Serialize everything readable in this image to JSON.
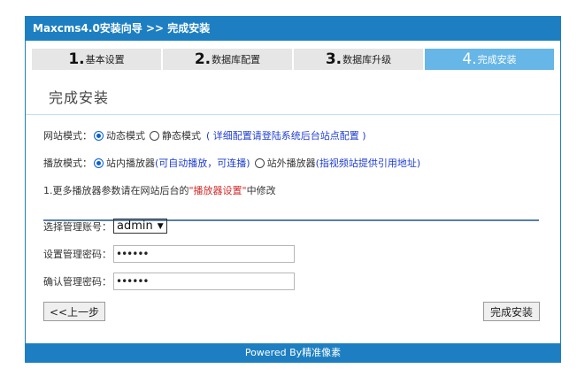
{
  "header": {
    "title": "Maxcms4.0安装向导 >> 完成安装"
  },
  "steps": [
    {
      "num": "1.",
      "label": "基本设置",
      "active": false
    },
    {
      "num": "2.",
      "label": "数据库配置",
      "active": false
    },
    {
      "num": "3.",
      "label": "数据库升级",
      "active": false
    },
    {
      "num": "4.",
      "label": "完成安装",
      "active": true
    }
  ],
  "section_title": "完成安装",
  "site_mode": {
    "label": "网站模式：",
    "options": [
      "动态模式",
      "静态模式"
    ],
    "selected": "动态模式",
    "hint": "( 详细配置请登陆系统后台站点配置 )"
  },
  "player_mode": {
    "label": "播放模式：",
    "option1": "站内播放器",
    "option1_hint": "(可自动播放，可连播)",
    "option2": "站外播放器",
    "option2_hint": "(指视频站提供引用地址)",
    "selected": "站内播放器"
  },
  "note": {
    "prefix": "1.更多播放器参数请在网站后台的",
    "highlight": "\"播放器设置\"",
    "suffix": "中修改"
  },
  "admin": {
    "account_label": "选择管理账号：",
    "account_value": "admin",
    "password_label": "设置管理密码：",
    "password_value": "••••••",
    "confirm_label": "确认管理密码：",
    "confirm_value": "••••••"
  },
  "buttons": {
    "prev": "<<上一步",
    "finish": "完成安装"
  },
  "footer": {
    "text": "Powered By精准像素"
  },
  "colors": {
    "primary": "#1d7fc2",
    "active_step": "#66b6e7",
    "link_blue": "#1f3fd0",
    "highlight_red": "#d42a2a"
  }
}
